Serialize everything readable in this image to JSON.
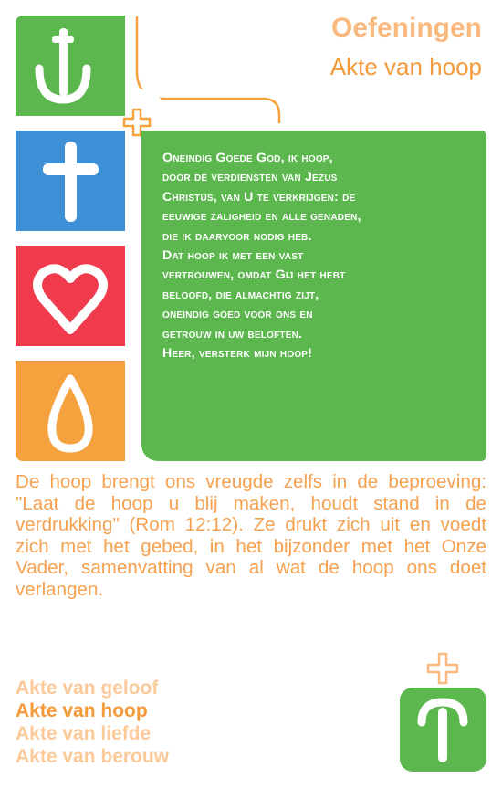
{
  "header": {
    "title": "Oefeningen",
    "subtitle": "Akte van hoop"
  },
  "colors": {
    "green": "#5cb84e",
    "blue": "#3d8fd6",
    "red": "#ef3b4b",
    "orange": "#f4a13e",
    "text_orange": "#f6a14f",
    "light_orange": "#fcc999"
  },
  "icons": [
    "anchor-icon",
    "cross-icon",
    "heart-icon",
    "drop-icon",
    "plus-icon",
    "anchor-small-icon"
  ],
  "prayer": {
    "lines": [
      "Oneindig Goede God, ik hoop,",
      "door de verdiensten van Jezus",
      "Christus, van U te verkrijgen: de",
      "eeuwige zaligheid en alle genaden,",
      "die ik daarvoor nodig heb.",
      "Dat hoop ik met een vast",
      "vertrouwen, omdat Gij het hebt",
      "beloofd, die almachtig zijt,",
      "oneindig goed voor ons en",
      "getrouw in uw beloften.",
      "Heer, versterk mijn hoop!"
    ]
  },
  "body": {
    "text": "De hoop brengt ons vreugde zelfs in de beproeving: \"Laat de hoop u blij maken, houdt stand in de verdrukking\" (Rom 12:12). Ze drukt zich uit en voedt zich met het gebed, in het bijzonder met het Onze Vader, samenvatting van al wat de hoop ons doet verlangen."
  },
  "acts": [
    {
      "label": "Akte van geloof",
      "active": false
    },
    {
      "label": "Akte van hoop",
      "active": true
    },
    {
      "label": "Akte van liefde",
      "active": false
    },
    {
      "label": "Akte van berouw",
      "active": false
    }
  ]
}
